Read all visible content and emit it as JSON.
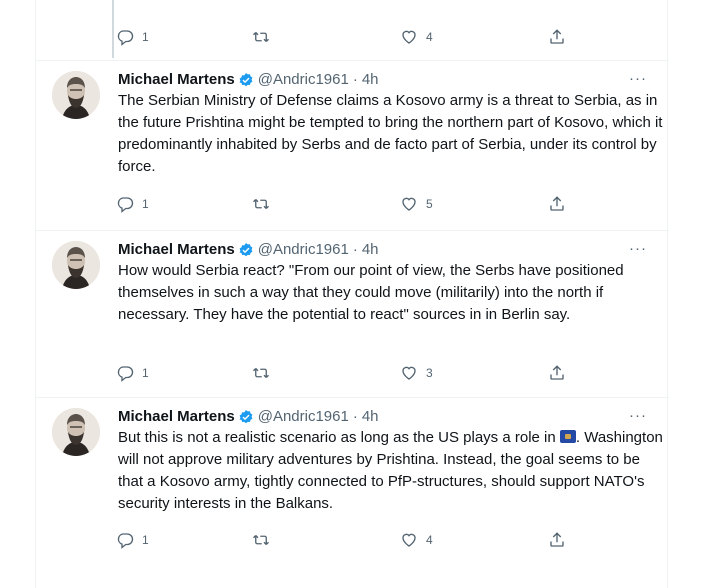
{
  "top_actions": {
    "replies": "1",
    "retweets": "",
    "likes": "4"
  },
  "tweets": [
    {
      "name": "Michael Martens",
      "handle": "@Andric1961",
      "dot": "·",
      "time": "4h",
      "more": "···",
      "text": "The Serbian Ministry of Defense claims a Kosovo army is a threat to Serbia, as in the future Prishtina might be tempted to bring the northern part of Kosovo, which it predominantly inhabited by Serbs and de facto part of Serbia, under its control by force.",
      "replies": "1",
      "retweets": "",
      "likes": "5"
    },
    {
      "name": "Michael Martens",
      "handle": "@Andric1961",
      "dot": "·",
      "time": "4h",
      "more": "···",
      "text": "How would Serbia react? \"From our point of view, the Serbs have positioned themselves in such a way that they could move (militarily) into the north if necessary. They have the potential to react\" sources in in Berlin say.",
      "replies": "1",
      "retweets": "",
      "likes": "3"
    },
    {
      "name": "Michael Martens",
      "handle": "@Andric1961",
      "dot": "·",
      "time": "4h",
      "more": "···",
      "text_before_flag": "But this is not a realistic scenario as long as the US plays a role in ",
      "text_after_flag": ". Washington will not approve military adventures by Prishtina. Instead, the goal seems to be that a Kosovo army, tightly connected to PfP-structures, should support NATO's security interests in the Balkans.",
      "replies": "1",
      "retweets": "",
      "likes": "4"
    }
  ],
  "icons": {
    "reply": "reply-icon",
    "retweet": "retweet-icon",
    "like": "like-icon",
    "share": "share-icon",
    "verified": "verified-badge-icon",
    "flag": "kosovo-flag-icon"
  },
  "colors": {
    "text": "#0f1419",
    "secondary": "#536471",
    "verified": "#1d9bf0",
    "border": "#eff3f4",
    "thread": "#cfd9de"
  }
}
